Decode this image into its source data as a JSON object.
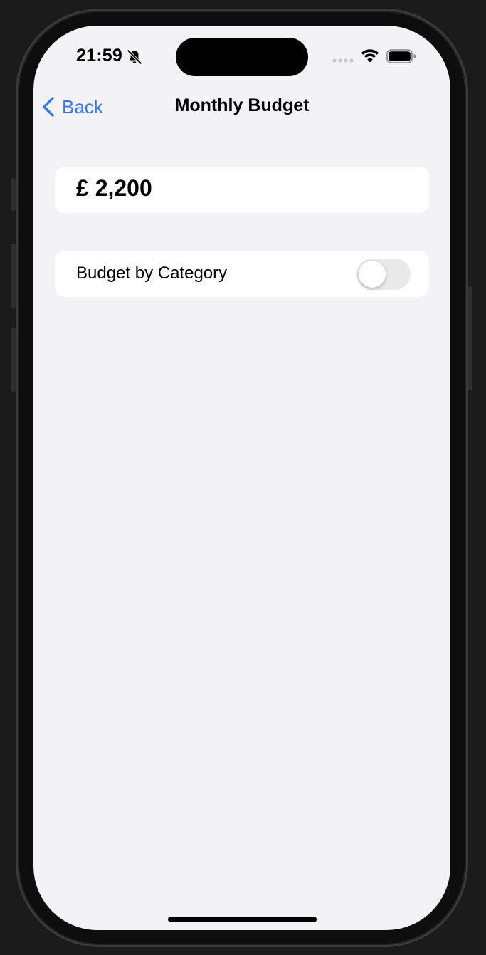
{
  "status_bar": {
    "time": "21:59",
    "icons": [
      "bell-slash-icon",
      "signal-dots-icon",
      "wifi-icon",
      "battery-icon"
    ]
  },
  "nav": {
    "back_label": "Back",
    "title": "Monthly Budget"
  },
  "budget": {
    "amount": "£ 2,200"
  },
  "category_row": {
    "label": "Budget by Category",
    "toggle_on": false
  },
  "colors": {
    "accent": "#3478f6",
    "background": "#f2f2f7",
    "card": "#ffffff",
    "toggle_off": "#e9e9ea"
  }
}
